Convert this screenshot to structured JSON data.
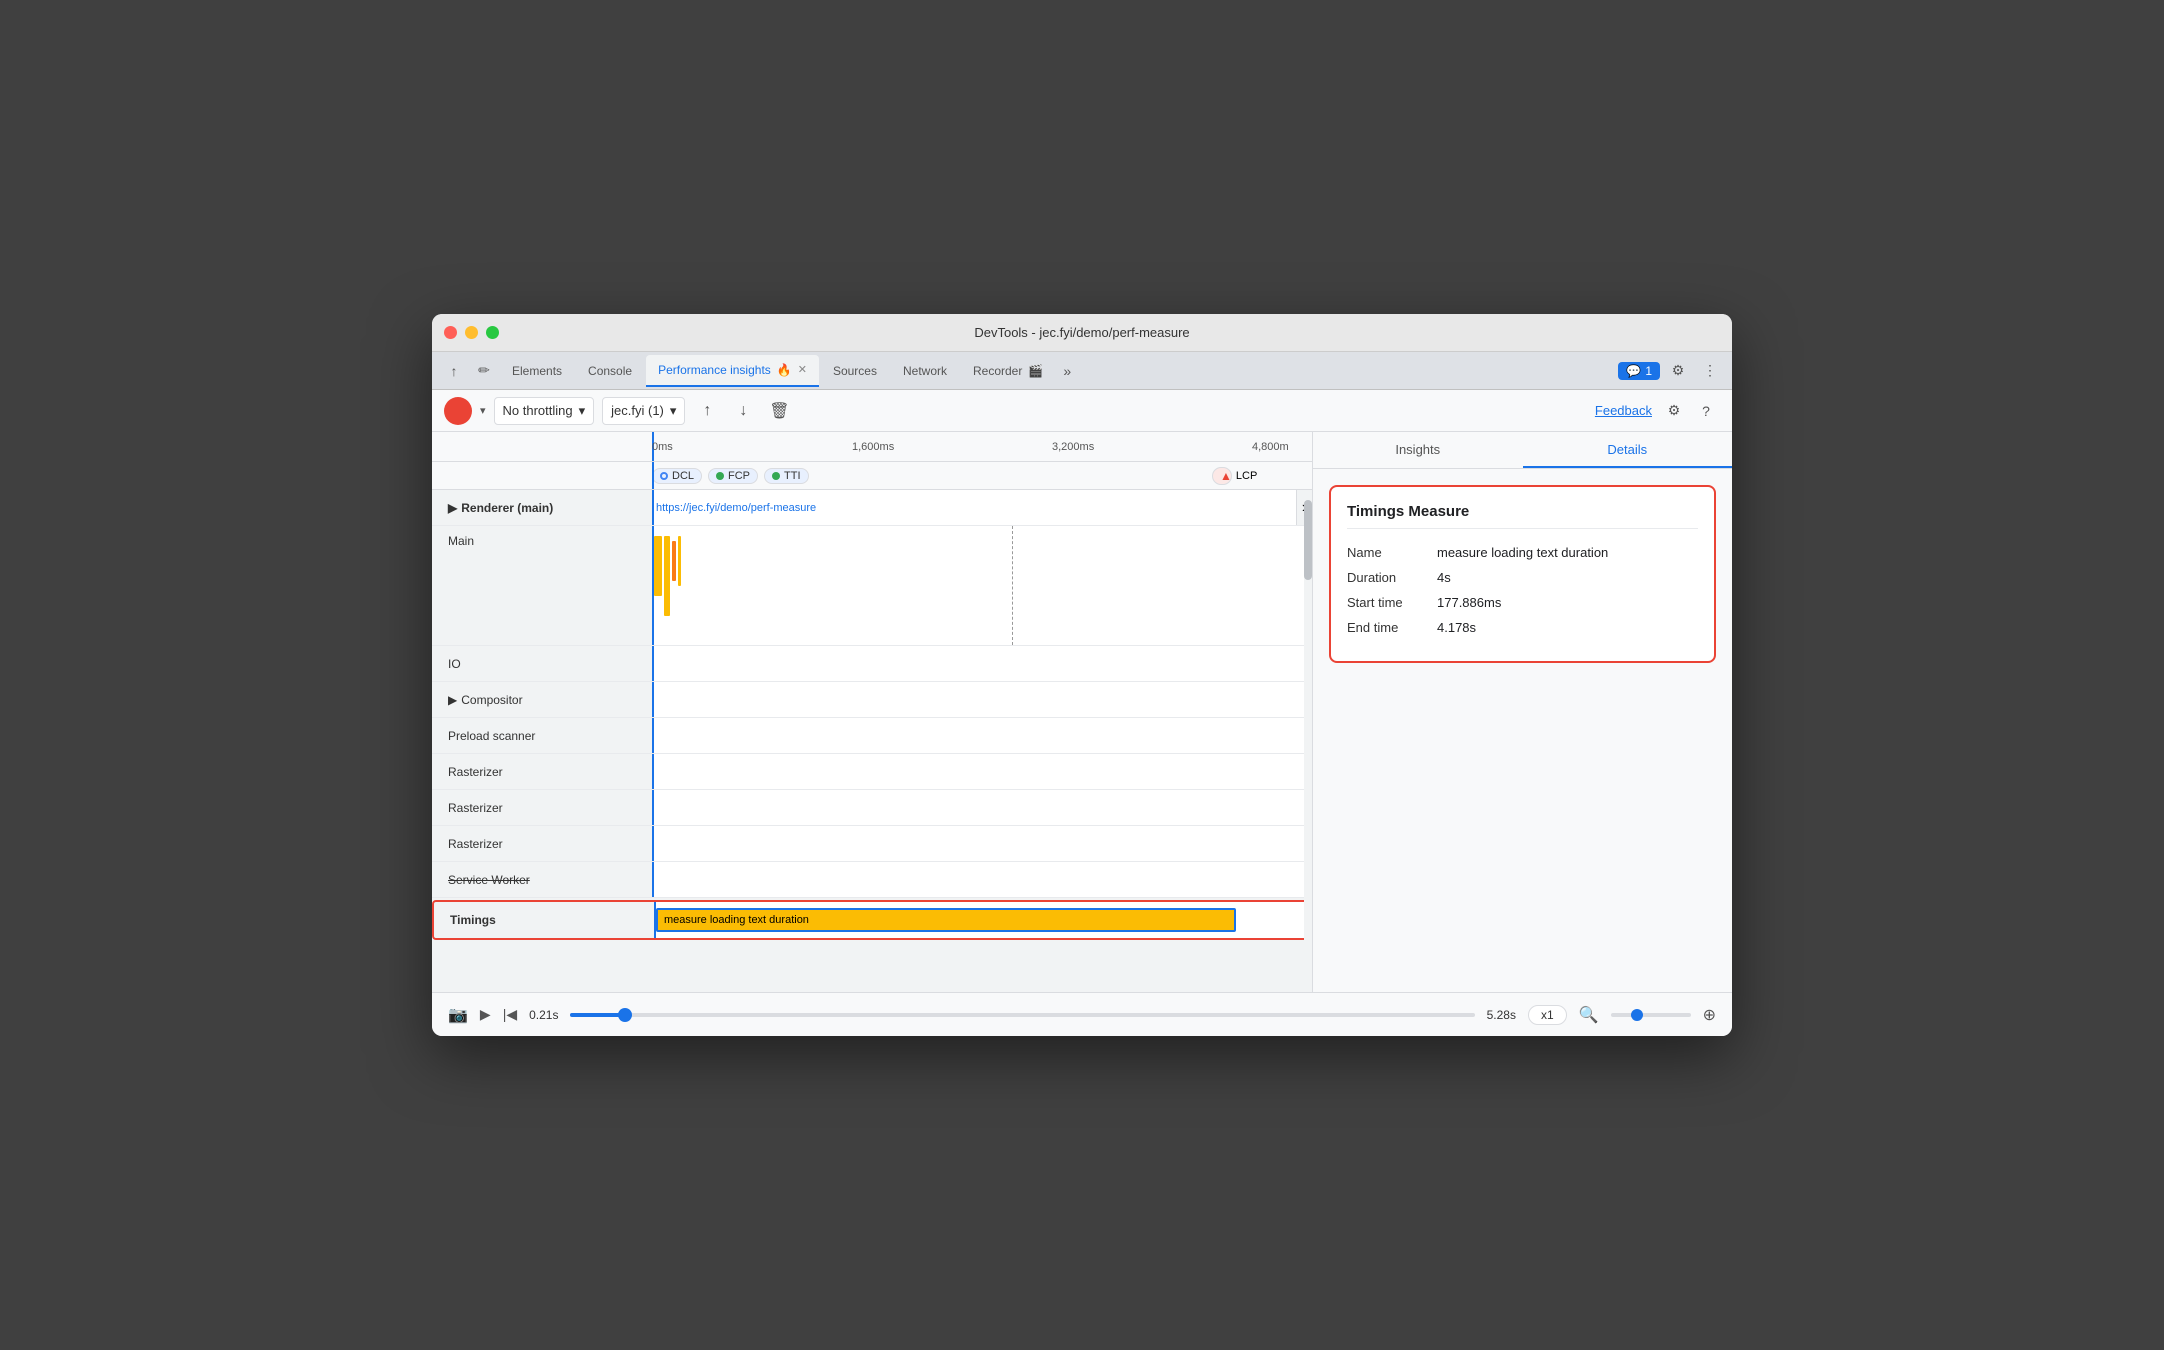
{
  "window": {
    "title": "DevTools - jec.fyi/demo/perf-measure"
  },
  "tabs": {
    "items": [
      {
        "label": "Elements",
        "active": false
      },
      {
        "label": "Console",
        "active": false
      },
      {
        "label": "Performance insights",
        "active": true
      },
      {
        "label": "Sources",
        "active": false
      },
      {
        "label": "Network",
        "active": false
      },
      {
        "label": "Recorder",
        "active": false
      }
    ],
    "more_label": "»",
    "chat_badge": "1"
  },
  "toolbar": {
    "throttle_label": "No throttling",
    "recording_label": "jec.fyi (1)",
    "feedback_label": "Feedback"
  },
  "timeline": {
    "time_markers": [
      "0ms",
      "1,600ms",
      "3,200ms",
      "4,800m"
    ],
    "url": "https://jec.fyi/demo/perf-measure",
    "markers": {
      "dcl": "DCL",
      "fcp": "FCP",
      "tti": "TTI",
      "lcp": "LCP"
    },
    "tracks": [
      {
        "label": "Renderer (main)",
        "bold": true,
        "expand": true
      },
      {
        "label": "Main"
      },
      {
        "label": ""
      },
      {
        "label": ""
      },
      {
        "label": ""
      },
      {
        "label": "IO"
      },
      {
        "label": "Compositor",
        "expand": true
      },
      {
        "label": "Preload scanner"
      },
      {
        "label": "Rasterizer"
      },
      {
        "label": "Rasterizer"
      },
      {
        "label": "Rasterizer"
      },
      {
        "label": "Service Worker"
      }
    ],
    "timings_label": "Timings",
    "timing_bar_label": "measure loading text duration"
  },
  "right_panel": {
    "tabs": [
      "Insights",
      "Details"
    ],
    "active_tab": "Details",
    "details": {
      "title": "Timings Measure",
      "rows": [
        {
          "label": "Name",
          "value": "measure loading text duration"
        },
        {
          "label": "Duration",
          "value": "4s"
        },
        {
          "label": "Start time",
          "value": "177.886ms"
        },
        {
          "label": "End time",
          "value": "4.178s"
        }
      ]
    }
  },
  "bottom_bar": {
    "time_start": "0.21s",
    "time_end": "5.28s",
    "zoom_level": "x1"
  }
}
